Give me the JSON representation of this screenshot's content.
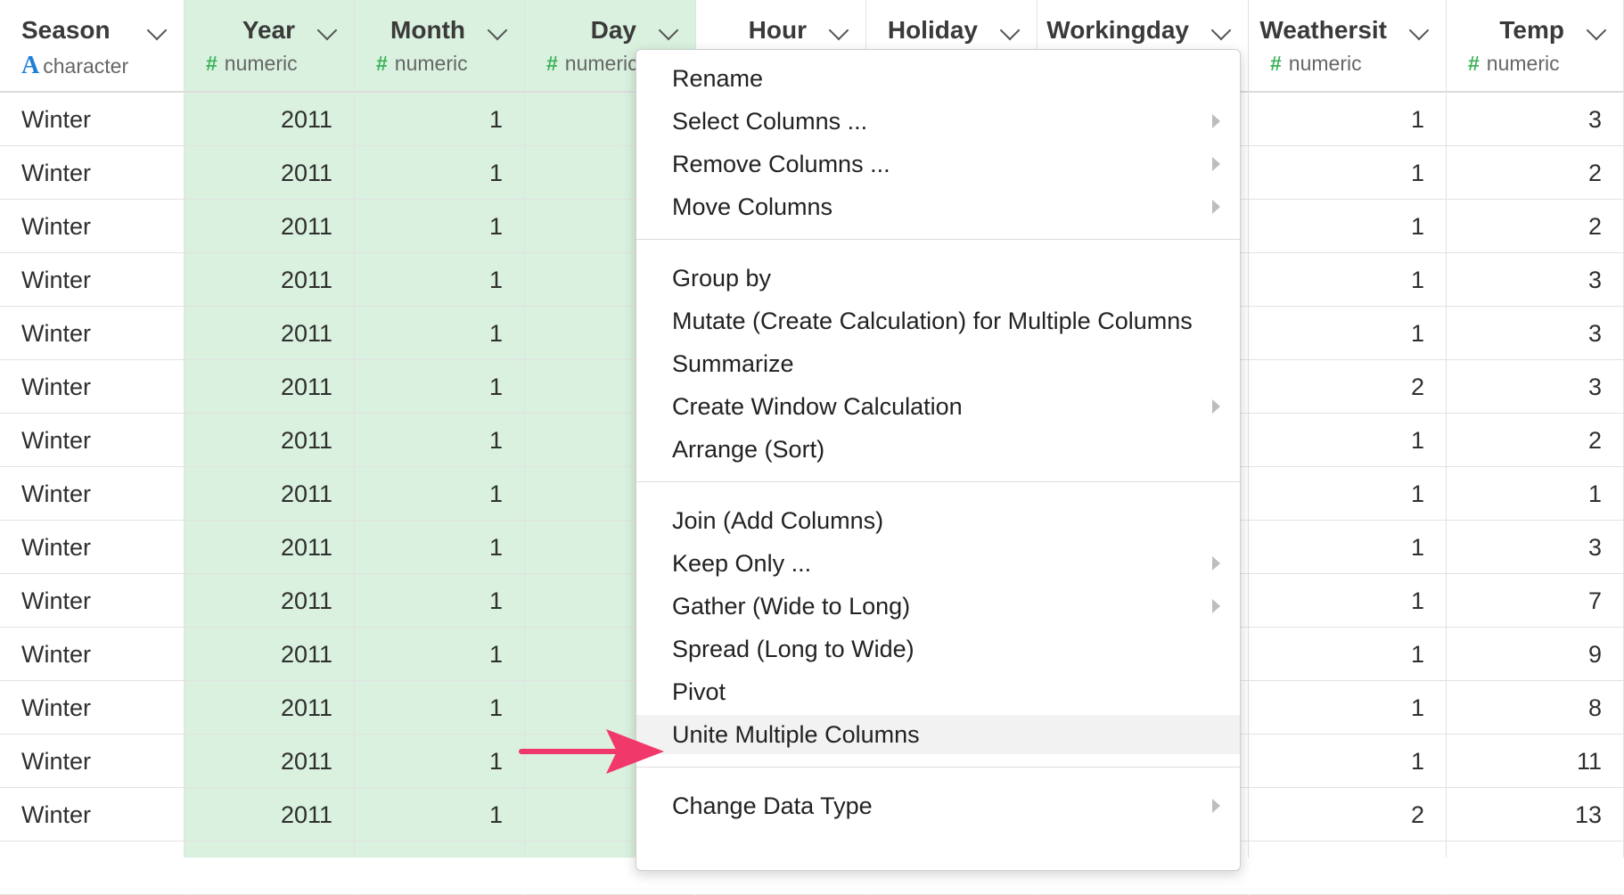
{
  "columns": [
    {
      "name": "Season",
      "type": "character",
      "align": "left",
      "selected": false,
      "values": [
        "Winter",
        "Winter",
        "Winter",
        "Winter",
        "Winter",
        "Winter",
        "Winter",
        "Winter",
        "Winter",
        "Winter",
        "Winter",
        "Winter",
        "Winter",
        "Winter"
      ]
    },
    {
      "name": "Year",
      "type": "numeric",
      "align": "right",
      "selected": true,
      "values": [
        "2011",
        "2011",
        "2011",
        "2011",
        "2011",
        "2011",
        "2011",
        "2011",
        "2011",
        "2011",
        "2011",
        "2011",
        "2011",
        "2011"
      ]
    },
    {
      "name": "Month",
      "type": "numeric",
      "align": "right",
      "selected": true,
      "values": [
        "1",
        "1",
        "1",
        "1",
        "1",
        "1",
        "1",
        "1",
        "1",
        "1",
        "1",
        "1",
        "1",
        "1"
      ]
    },
    {
      "name": "Day",
      "type": "numeric",
      "align": "right",
      "selected": true,
      "values": []
    },
    {
      "name": "Hour",
      "type": "",
      "align": "right",
      "selected": false,
      "values": []
    },
    {
      "name": "Holiday",
      "type": "",
      "align": "right",
      "selected": false,
      "values": []
    },
    {
      "name": "Workingday",
      "type": "",
      "align": "right",
      "selected": false,
      "values": []
    },
    {
      "name": "Weathersit",
      "type": "numeric",
      "align": "right",
      "selected": false,
      "values": [
        "1",
        "1",
        "1",
        "1",
        "1",
        "2",
        "1",
        "1",
        "1",
        "1",
        "1",
        "1",
        "1",
        "2"
      ]
    },
    {
      "name": "Temp",
      "type": "numeric",
      "align": "right",
      "selected": false,
      "values": [
        "3",
        "2",
        "2",
        "3",
        "3",
        "3",
        "2",
        "1",
        "3",
        "7",
        "9",
        "8",
        "11",
        "13"
      ]
    }
  ],
  "type_labels": {
    "character": "character",
    "numeric": "numeric",
    "character_symbol": "A",
    "numeric_symbol": "#"
  },
  "context_menu": {
    "groups": [
      [
        {
          "label": "Rename",
          "submenu": false
        },
        {
          "label": "Select Columns ...",
          "submenu": true
        },
        {
          "label": "Remove Columns ...",
          "submenu": true
        },
        {
          "label": "Move Columns",
          "submenu": true
        }
      ],
      [
        {
          "label": "Group by",
          "submenu": false
        },
        {
          "label": "Mutate (Create Calculation) for Multiple Columns",
          "submenu": false
        },
        {
          "label": "Summarize",
          "submenu": false
        },
        {
          "label": "Create Window Calculation",
          "submenu": true
        },
        {
          "label": "Arrange (Sort)",
          "submenu": false
        }
      ],
      [
        {
          "label": "Join (Add Columns)",
          "submenu": false
        },
        {
          "label": "Keep Only ...",
          "submenu": true
        },
        {
          "label": "Gather (Wide to Long)",
          "submenu": true
        },
        {
          "label": "Spread (Long to Wide)",
          "submenu": false
        },
        {
          "label": "Pivot",
          "submenu": false
        },
        {
          "label": "Unite Multiple Columns",
          "submenu": false,
          "highlighted": true
        }
      ],
      [
        {
          "label": "Change Data Type",
          "submenu": true
        }
      ]
    ]
  },
  "colors": {
    "selected_column": "#d9f1de",
    "arrow": "#f0386b",
    "numeric_symbol": "#3db35a",
    "character_symbol": "#1f7fd6"
  }
}
